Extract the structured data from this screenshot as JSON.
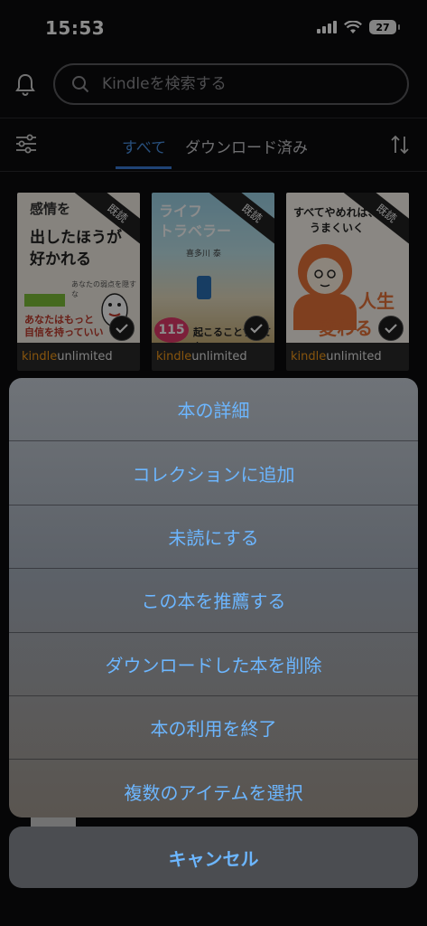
{
  "status": {
    "time": "15:53",
    "battery": "27"
  },
  "header": {
    "search_placeholder": "Kindleを検索する"
  },
  "tabs": [
    {
      "label": "すべて",
      "active": true
    },
    {
      "label": "ダウンロード済み",
      "active": false
    }
  ],
  "books": [
    {
      "title_lines": [
        "感情を",
        "出したほうが",
        "好かれる"
      ],
      "subtitle": "あなたの弱点を隠すな",
      "band": "あなたはもっと",
      "band2": "自信を持っていい",
      "ribbon": "既読",
      "badge_ku": "kindle",
      "badge_ku2": "unlimited"
    },
    {
      "title_lines": [
        "ライフ",
        "トラベラー"
      ],
      "subtitle": "喜多川 泰",
      "band": "115",
      "band2": "起こることすべてを",
      "ribbon": "既読",
      "badge_ku": "kindle",
      "badge_ku2": "unlimited"
    },
    {
      "title_lines": [
        "すべてやめれば、",
        "うまくいく"
      ],
      "subtitle": "",
      "band": "人生",
      "band2": "変わる",
      "ribbon": "既読",
      "badge_ku": "kindle",
      "badge_ku2": "unlimited"
    }
  ],
  "action_sheet": {
    "items": [
      "本の詳細",
      "コレクションに追加",
      "未読にする",
      "この本を推薦する",
      "ダウンロードした本を削除",
      "本の利用を終了",
      "複数のアイテムを選択"
    ],
    "cancel": "キャンセル"
  },
  "colors": {
    "accent": "#6cb6ff",
    "tab_active": "#4a90e2",
    "ku_orange": "#f59a1a"
  }
}
